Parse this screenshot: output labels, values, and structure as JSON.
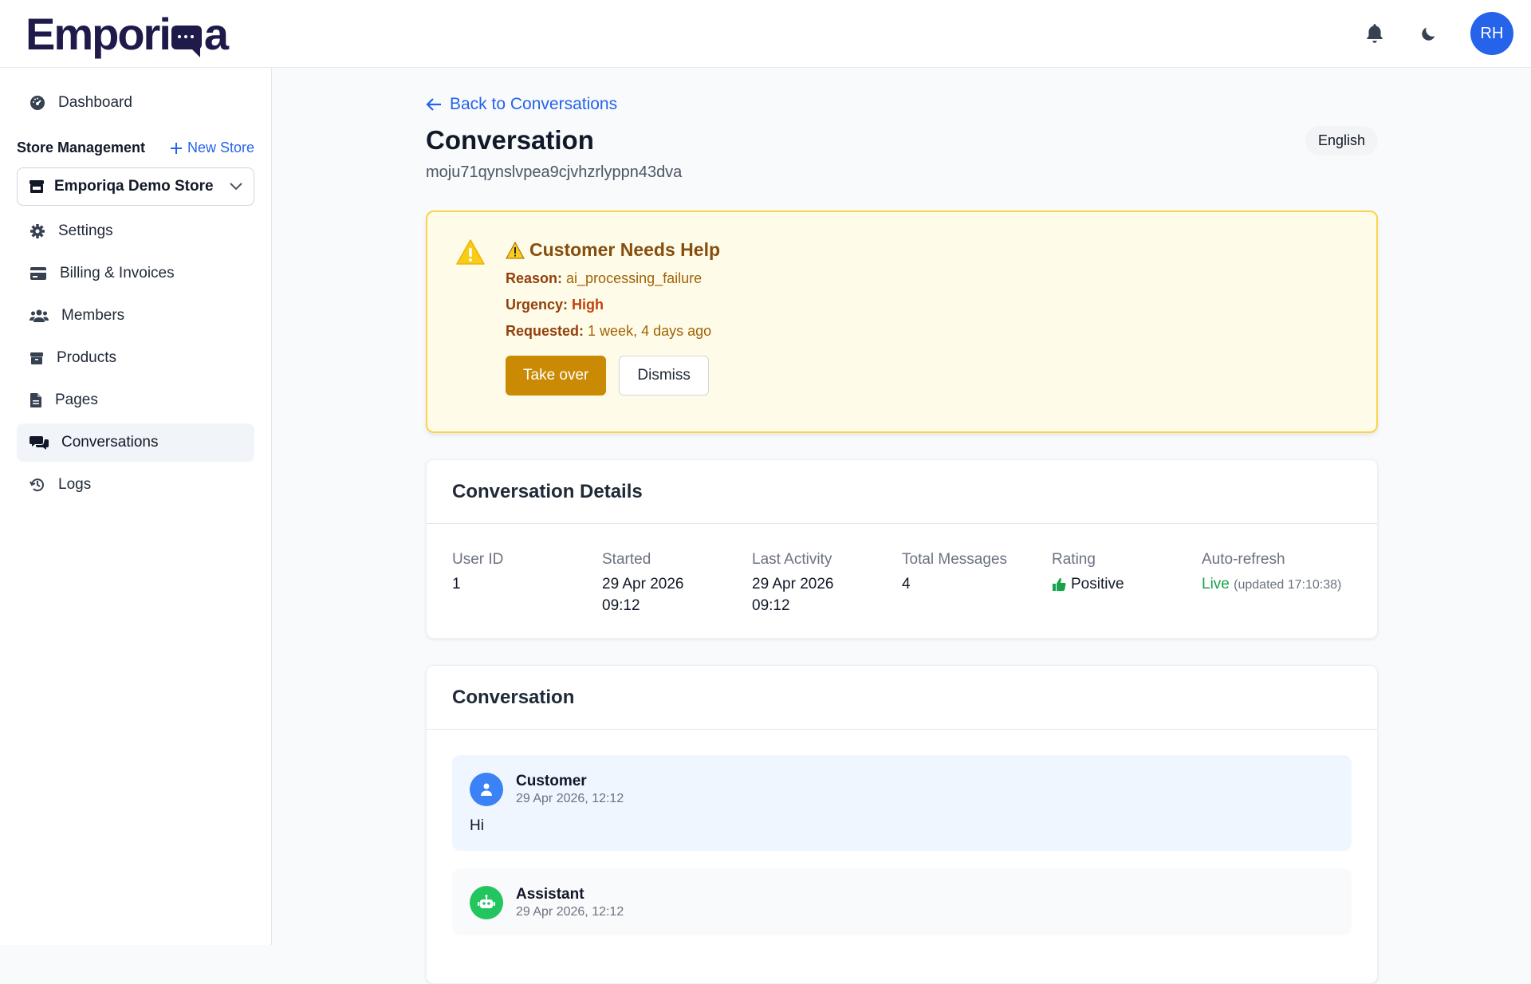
{
  "app": {
    "logo_text_left": "Empori",
    "logo_text_right": "a"
  },
  "topbar": {
    "avatar_initials": "RH",
    "icons": [
      "bell-icon",
      "moon-icon"
    ]
  },
  "sidebar": {
    "dashboard": "Dashboard",
    "section_title": "Store Management",
    "new_store": "New Store",
    "store_selected": "Emporiqa Demo Store",
    "items": [
      {
        "label": "Settings",
        "icon": "gear-icon"
      },
      {
        "label": "Billing & Invoices",
        "icon": "credit-card-icon"
      },
      {
        "label": "Members",
        "icon": "users-icon"
      },
      {
        "label": "Products",
        "icon": "box-icon"
      },
      {
        "label": "Pages",
        "icon": "file-icon"
      },
      {
        "label": "Conversations",
        "icon": "chat-icon",
        "active": true
      },
      {
        "label": "Logs",
        "icon": "history-icon"
      }
    ]
  },
  "main": {
    "back_link": "Back to Conversations",
    "title": "Conversation",
    "language": "English",
    "conversation_id": "moju71qynslvpea9cjvhzrlyppn43dva"
  },
  "alert": {
    "title": "Customer Needs Help",
    "reason_label": "Reason:",
    "reason_value": "ai_processing_failure",
    "urgency_label": "Urgency:",
    "urgency_value": "High",
    "requested_label": "Requested:",
    "requested_value": "1 week, 4 days ago",
    "take_over": "Take over",
    "dismiss": "Dismiss"
  },
  "details": {
    "title": "Conversation Details",
    "user_id_label": "User ID",
    "user_id": "1",
    "started_label": "Started",
    "started_date": "29 Apr 2026",
    "started_time": "09:12",
    "last_activity_label": "Last Activity",
    "last_activity_date": "29 Apr 2026",
    "last_activity_time": "09:12",
    "total_messages_label": "Total Messages",
    "total_messages": "4",
    "rating_label": "Rating",
    "rating": "Positive",
    "auto_refresh_label": "Auto-refresh",
    "auto_refresh_status": "Live",
    "auto_refresh_updated": "(updated 17:10:38)"
  },
  "conversation": {
    "title": "Conversation",
    "messages": [
      {
        "role": "Customer",
        "time": "29 Apr 2026, 12:12",
        "text": "Hi"
      },
      {
        "role": "Assistant",
        "time": "29 Apr 2026, 12:12",
        "text": ""
      }
    ]
  },
  "colors": {
    "accent": "#2563eb",
    "warning": "#ca8a04",
    "success": "#16a34a"
  }
}
